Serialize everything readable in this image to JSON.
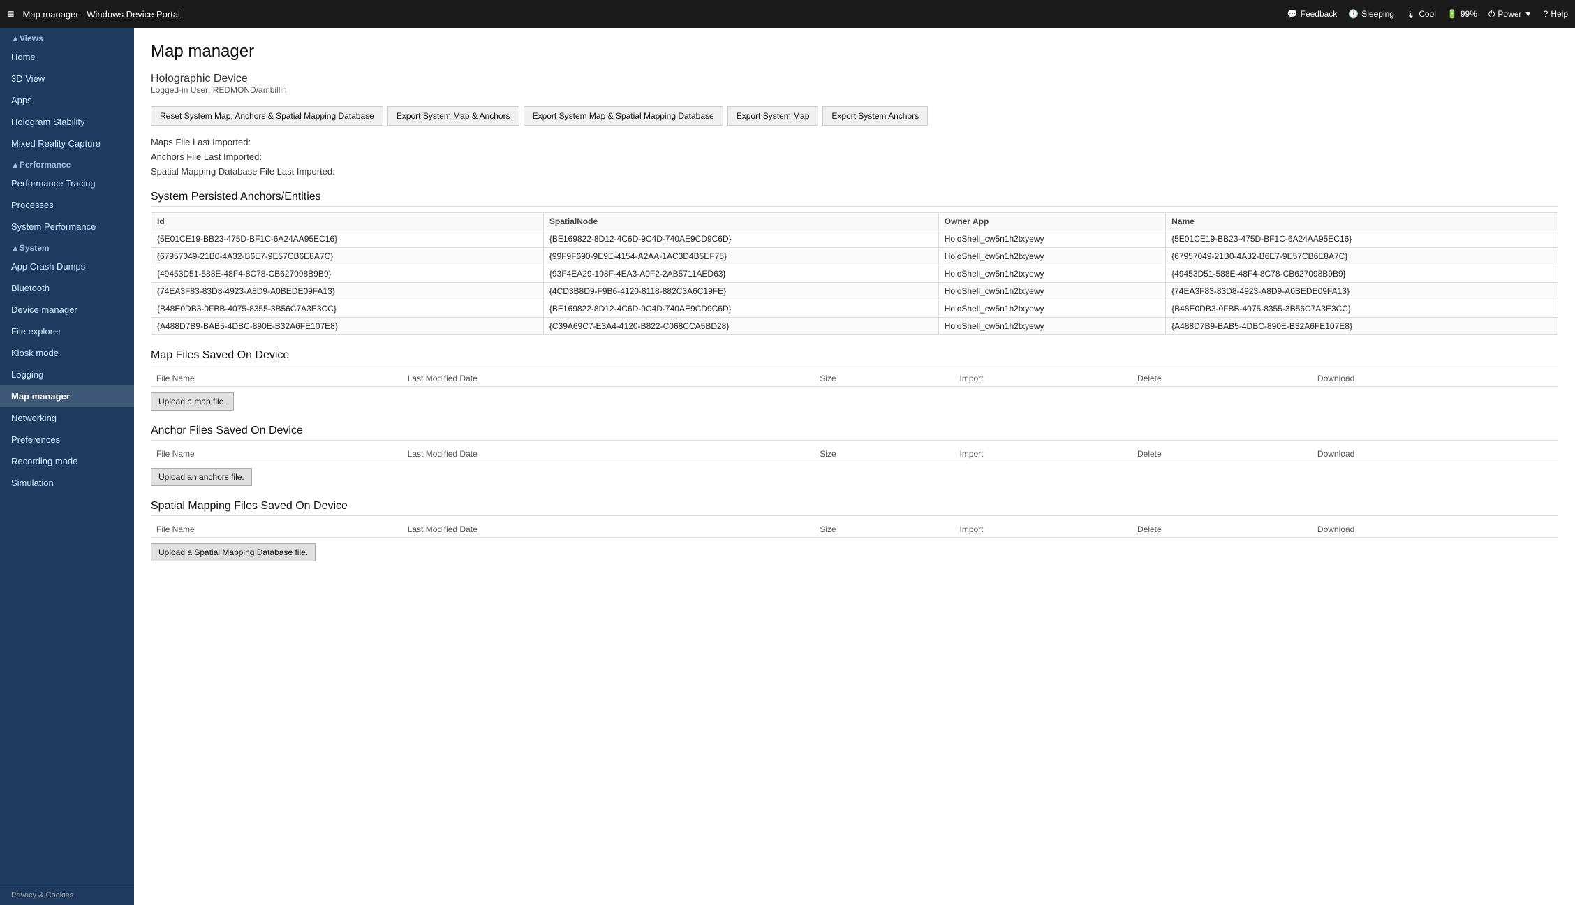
{
  "topbar": {
    "title": "Map manager - Windows Device Portal",
    "hamburger": "≡",
    "actions": [
      {
        "id": "feedback",
        "icon": "💬",
        "label": "Feedback"
      },
      {
        "id": "sleeping",
        "icon": "🕐",
        "label": "Sleeping"
      },
      {
        "id": "cool",
        "icon": "🌡",
        "label": "Cool"
      },
      {
        "id": "battery",
        "icon": "🔋",
        "label": "99%"
      },
      {
        "id": "power",
        "icon": "⏻",
        "label": "Power ▼"
      },
      {
        "id": "help",
        "icon": "?",
        "label": "Help"
      }
    ]
  },
  "sidebar": {
    "collapse_icon": "◀",
    "views_header": "▲Views",
    "items_views": [
      {
        "id": "home",
        "label": "Home"
      },
      {
        "id": "3dview",
        "label": "3D View"
      },
      {
        "id": "apps",
        "label": "Apps"
      },
      {
        "id": "hologram-stability",
        "label": "Hologram Stability"
      },
      {
        "id": "mixed-reality-capture",
        "label": "Mixed Reality Capture"
      }
    ],
    "performance_header": "▲Performance",
    "items_performance": [
      {
        "id": "performance-tracing",
        "label": "Performance Tracing"
      },
      {
        "id": "processes",
        "label": "Processes"
      },
      {
        "id": "system-performance",
        "label": "System Performance"
      }
    ],
    "system_header": "▲System",
    "items_system": [
      {
        "id": "app-crash-dumps",
        "label": "App Crash Dumps"
      },
      {
        "id": "bluetooth",
        "label": "Bluetooth"
      },
      {
        "id": "device-manager",
        "label": "Device manager"
      },
      {
        "id": "file-explorer",
        "label": "File explorer"
      },
      {
        "id": "kiosk-mode",
        "label": "Kiosk mode"
      },
      {
        "id": "logging",
        "label": "Logging"
      },
      {
        "id": "map-manager",
        "label": "Map manager",
        "active": true
      },
      {
        "id": "networking",
        "label": "Networking"
      },
      {
        "id": "preferences",
        "label": "Preferences"
      },
      {
        "id": "recording-mode",
        "label": "Recording mode"
      },
      {
        "id": "simulation",
        "label": "Simulation"
      }
    ],
    "footer": "Privacy & Cookies"
  },
  "main": {
    "page_title": "Map manager",
    "device": {
      "name": "Holographic Device",
      "logged_in_label": "Logged-in User: REDMOND/ambillin"
    },
    "buttons": [
      {
        "id": "reset-system-map",
        "label": "Reset System Map, Anchors & Spatial Mapping Database"
      },
      {
        "id": "export-system-map-anchors",
        "label": "Export System Map & Anchors"
      },
      {
        "id": "export-system-map-spatial",
        "label": "Export System Map & Spatial Mapping Database"
      },
      {
        "id": "export-system-map",
        "label": "Export System Map"
      },
      {
        "id": "export-system-anchors",
        "label": "Export System Anchors"
      }
    ],
    "import_info": [
      {
        "id": "maps-last-imported",
        "label": "Maps File Last Imported:"
      },
      {
        "id": "anchors-last-imported",
        "label": "Anchors File Last Imported:"
      },
      {
        "id": "spatial-last-imported",
        "label": "Spatial Mapping Database File Last Imported:"
      }
    ],
    "anchors_section": {
      "title": "System Persisted Anchors/Entities",
      "columns": [
        "Id",
        "SpatialNode",
        "Owner App",
        "Name"
      ],
      "rows": [
        {
          "id": "{5E01CE19-BB23-475D-BF1C-6A24AA95EC16}",
          "spatial_node": "{BE169822-8D12-4C6D-9C4D-740AE9CD9C6D}",
          "owner_app": "HoloShell_cw5n1h2txyewy",
          "name": "{5E01CE19-BB23-475D-BF1C-6A24AA95EC16}"
        },
        {
          "id": "{67957049-21B0-4A32-B6E7-9E57CB6E8A7C}",
          "spatial_node": "{99F9F690-9E9E-4154-A2AA-1AC3D4B5EF75}",
          "owner_app": "HoloShell_cw5n1h2txyewy",
          "name": "{67957049-21B0-4A32-B6E7-9E57CB6E8A7C}"
        },
        {
          "id": "{49453D51-588E-48F4-8C78-CB627098B9B9}",
          "spatial_node": "{93F4EA29-108F-4EA3-A0F2-2AB5711AED63}",
          "owner_app": "HoloShell_cw5n1h2txyewy",
          "name": "{49453D51-588E-48F4-8C78-CB627098B9B9}"
        },
        {
          "id": "{74EA3F83-83D8-4923-A8D9-A0BEDE09FA13}",
          "spatial_node": "{4CD3B8D9-F9B6-4120-8118-882C3A6C19FE}",
          "owner_app": "HoloShell_cw5n1h2txyewy",
          "name": "{74EA3F83-83D8-4923-A8D9-A0BEDE09FA13}"
        },
        {
          "id": "{B48E0DB3-0FBB-4075-8355-3B56C7A3E3CC}",
          "spatial_node": "{BE169822-8D12-4C6D-9C4D-740AE9CD9C6D}",
          "owner_app": "HoloShell_cw5n1h2txyewy",
          "name": "{B48E0DB3-0FBB-4075-8355-3B56C7A3E3CC}"
        },
        {
          "id": "{A488D7B9-BAB5-4DBC-890E-B32A6FE107E8}",
          "spatial_node": "{C39A69C7-E3A4-4120-B822-C068CCA5BD28}",
          "owner_app": "HoloShell_cw5n1h2txyewy",
          "name": "{A488D7B9-BAB5-4DBC-890E-B32A6FE107E8}"
        }
      ]
    },
    "map_files": {
      "title": "Map Files Saved On Device",
      "columns": [
        "File Name",
        "Last Modified Date",
        "Size",
        "Import",
        "Delete",
        "Download"
      ],
      "upload_label": "Upload a map file."
    },
    "anchor_files": {
      "title": "Anchor Files Saved On Device",
      "columns": [
        "File Name",
        "Last Modified Date",
        "Size",
        "Import",
        "Delete",
        "Download"
      ],
      "upload_label": "Upload an anchors file."
    },
    "spatial_files": {
      "title": "Spatial Mapping Files Saved On Device",
      "columns": [
        "File Name",
        "Last Modified Date",
        "Size",
        "Import",
        "Delete",
        "Download"
      ],
      "upload_label": "Upload a Spatial Mapping Database file."
    }
  }
}
